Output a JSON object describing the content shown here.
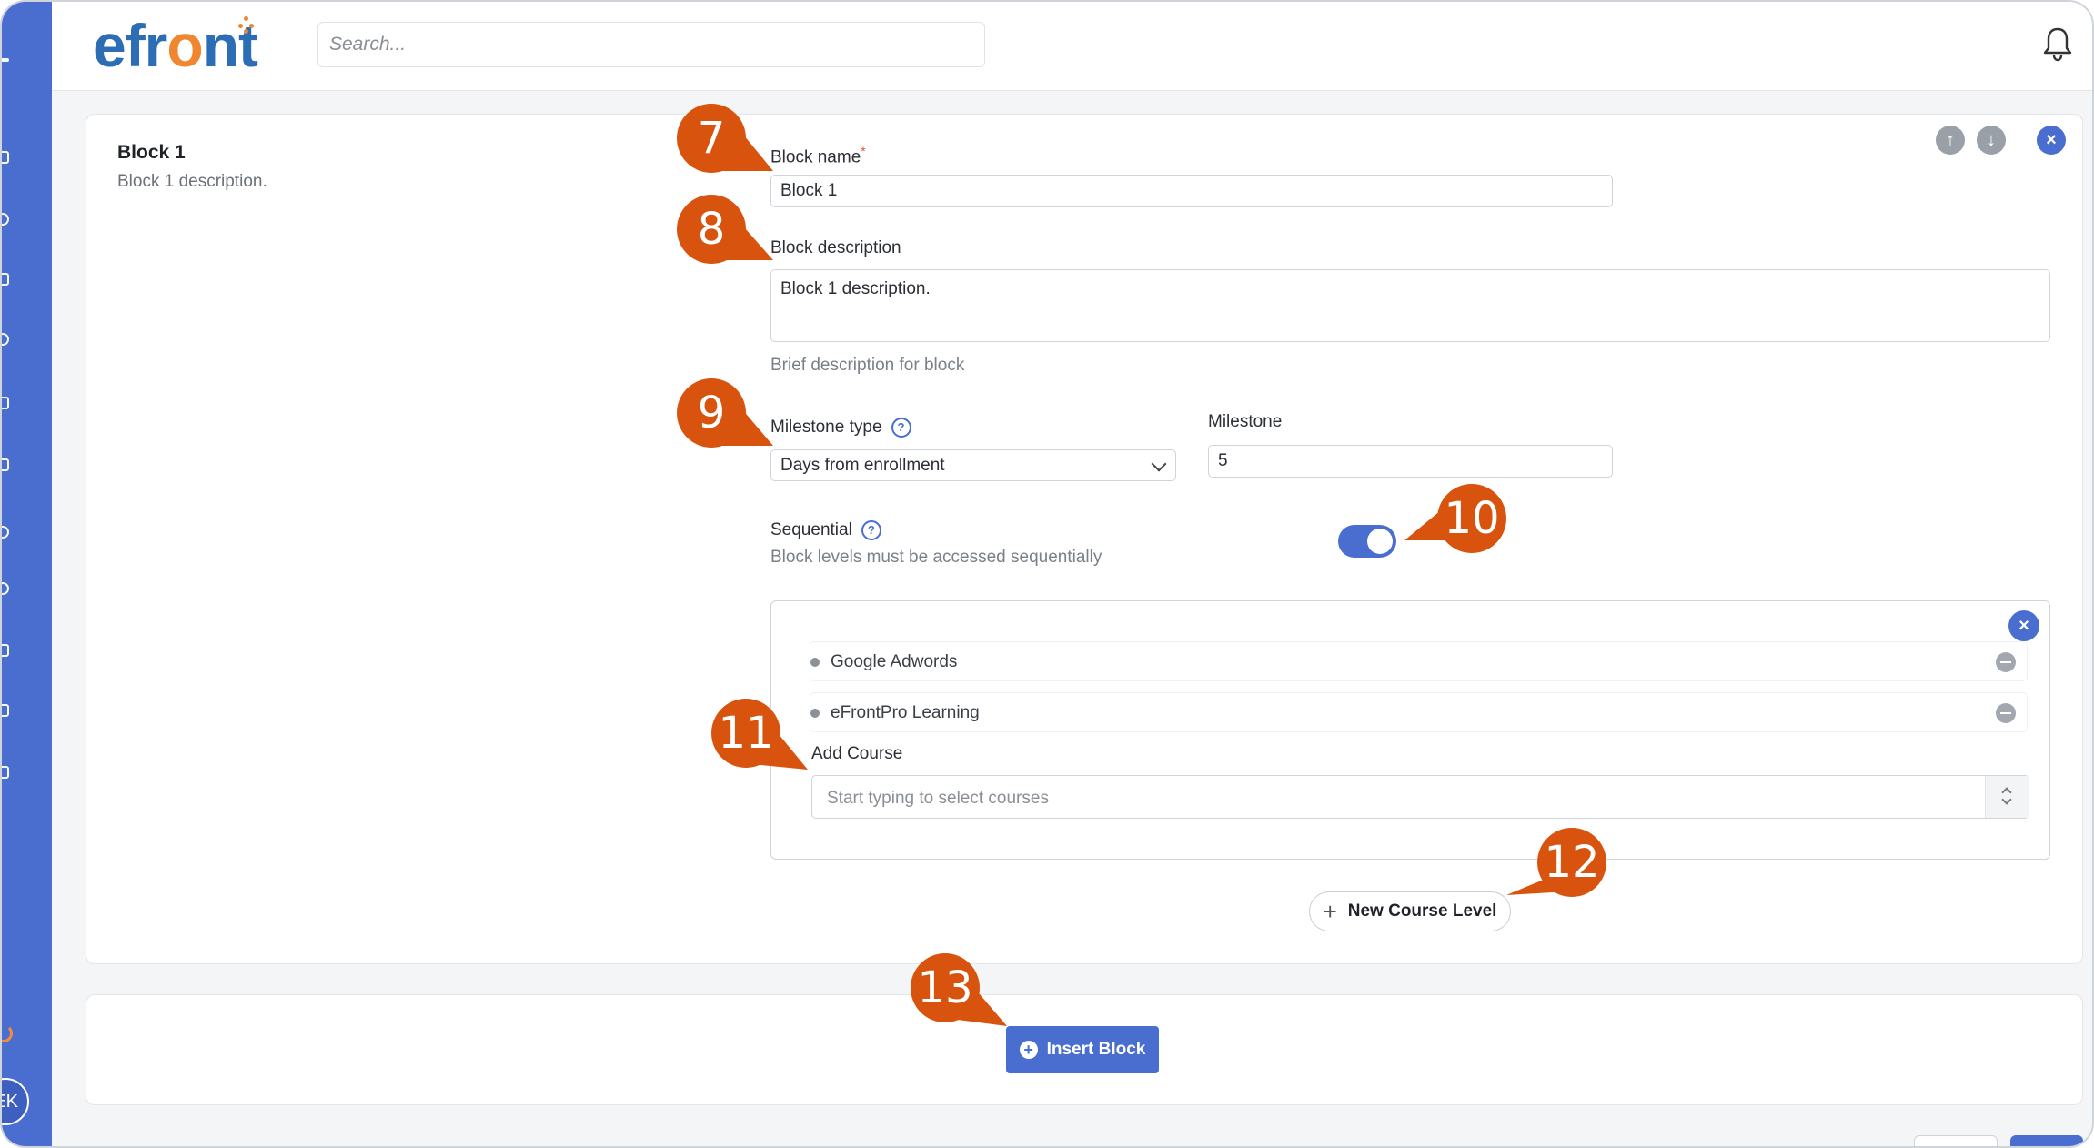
{
  "app": {
    "logo_text_pre": "efr",
    "logo_text_o": "o",
    "logo_text_post": "nt",
    "accent_color": "#4a6ecf",
    "callout_color": "#d8540e",
    "user_initials": "EK"
  },
  "header": {
    "search_placeholder": "Search..."
  },
  "block": {
    "title": "Block 1",
    "description": "Block 1 description.",
    "name_label": "Block name",
    "name_required_mark": "*",
    "name_value": "Block 1",
    "description_label": "Block description",
    "description_value": "Block 1 description.",
    "description_hint": "Brief description for block",
    "milestone_type_label": "Milestone type",
    "milestone_type_value": "Days from enrollment",
    "milestone_label": "Milestone",
    "milestone_value": "5",
    "sequential_label": "Sequential",
    "sequential_hint": "Block levels must be accessed sequentially",
    "sequential_on": true
  },
  "course_level": {
    "courses": [
      {
        "name": "Google Adwords"
      },
      {
        "name": "eFrontPro Learning"
      }
    ],
    "add_course_label": "Add Course",
    "add_course_placeholder": "Start typing to select courses"
  },
  "actions": {
    "new_course_level": "New Course Level",
    "insert_block": "Insert Block"
  },
  "callouts": [
    "7",
    "8",
    "9",
    "10",
    "11",
    "12",
    "13"
  ]
}
